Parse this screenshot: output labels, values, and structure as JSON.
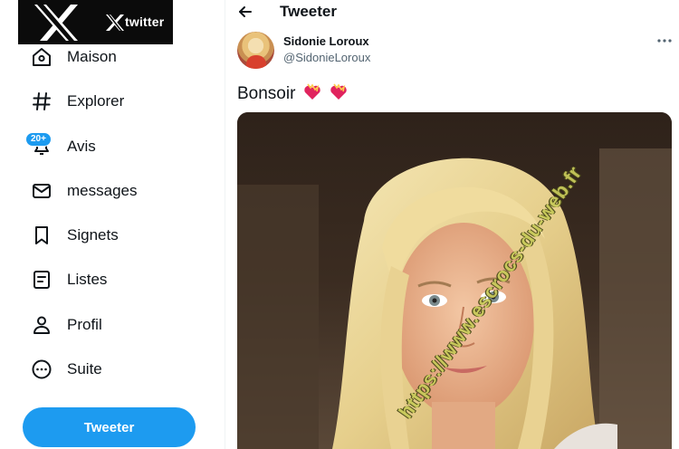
{
  "logo": {
    "word": "twitter"
  },
  "sidebar": {
    "items": [
      {
        "label": "Maison",
        "icon": "home-icon"
      },
      {
        "label": "Explorer",
        "icon": "hashtag-icon"
      },
      {
        "label": "Avis",
        "icon": "bell-icon",
        "badge": "20+"
      },
      {
        "label": "messages",
        "icon": "mail-icon"
      },
      {
        "label": "Signets",
        "icon": "bookmark-icon"
      },
      {
        "label": "Listes",
        "icon": "list-icon"
      },
      {
        "label": "Profil",
        "icon": "person-icon"
      },
      {
        "label": "Suite",
        "icon": "more-circle-icon"
      }
    ],
    "tweet_button": "Tweeter"
  },
  "header": {
    "title": "Tweeter"
  },
  "tweet": {
    "author_name": "Sidonie Loroux",
    "author_handle": "@SidonieLoroux",
    "text": "Bonsoir",
    "emoji": "heart-with-ribbon-emoji",
    "watermark": "https://www.escrocs-du-web.fr"
  },
  "colors": {
    "accent": "#1d9bf0",
    "text": "#0f1419",
    "secondary": "#536471"
  }
}
